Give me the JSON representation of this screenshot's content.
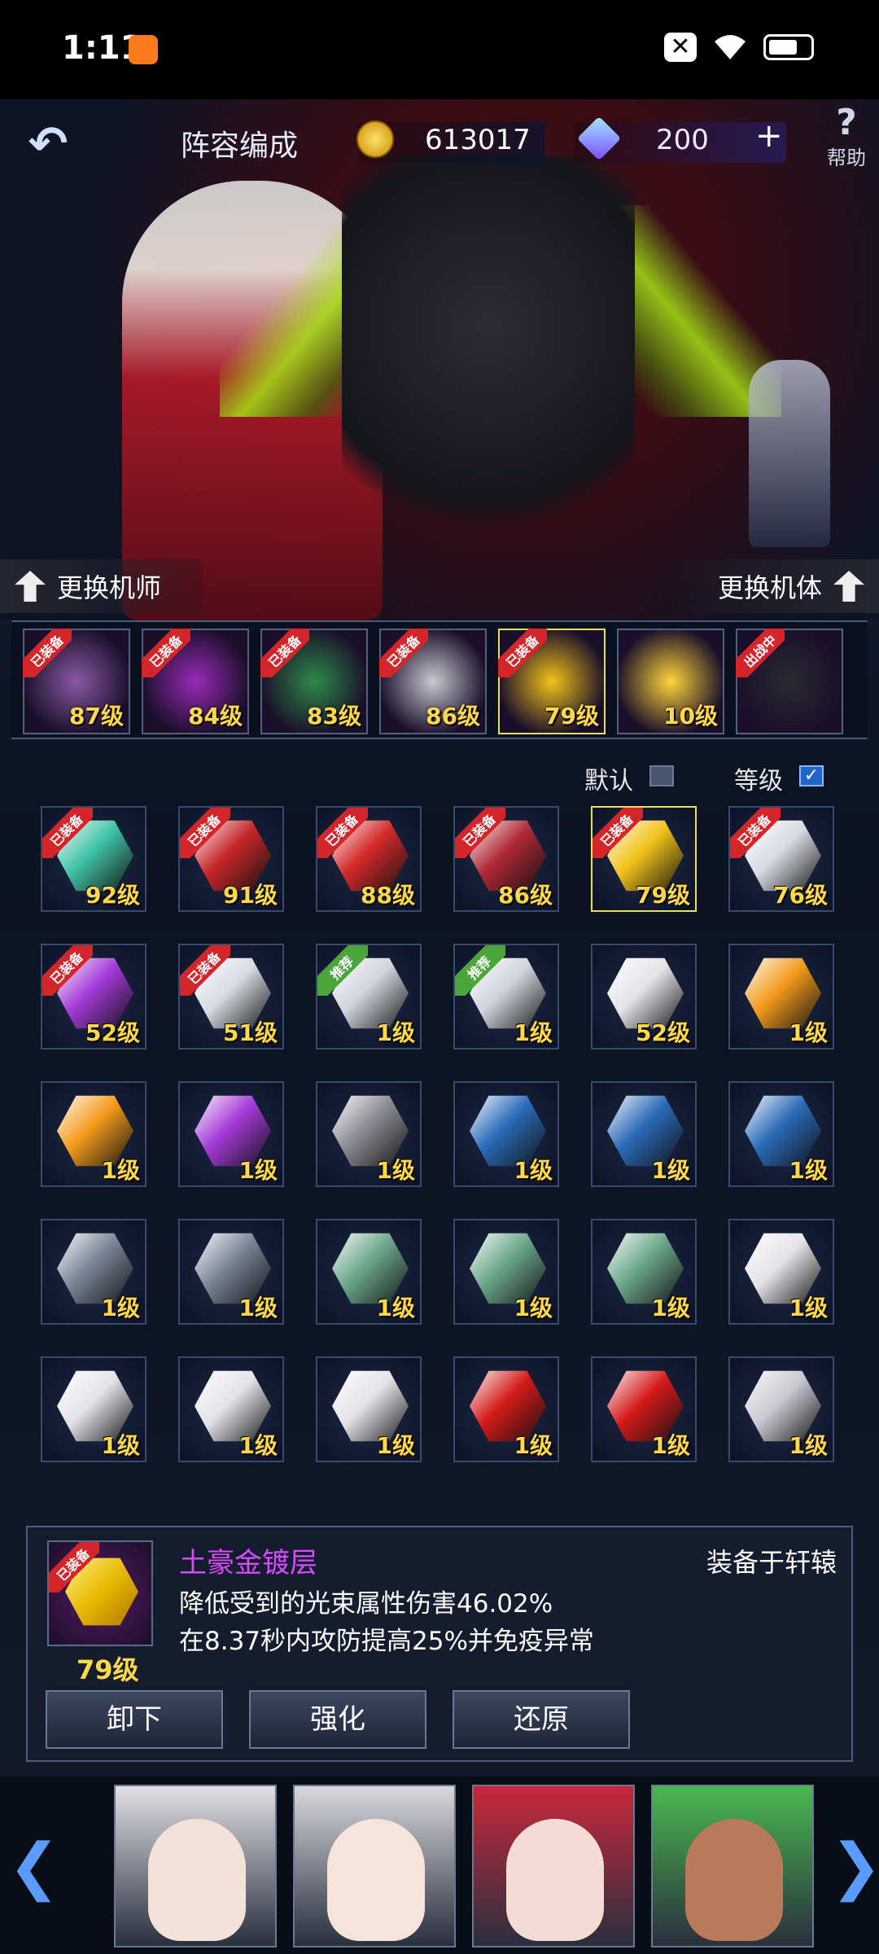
{
  "status_bar": {
    "time": "1:11"
  },
  "header": {
    "title": "阵容编成",
    "coins": "613017",
    "gems": "200",
    "plus": "+",
    "help_label": "帮助",
    "help_symbol": "?",
    "back_symbol": "↶"
  },
  "hero": {
    "change_pilot": "更换机师",
    "change_mech": "更换机体"
  },
  "equipped_strip": [
    {
      "tag": "已装备",
      "level": "87级",
      "color": "#8a5aa6"
    },
    {
      "tag": "已装备",
      "level": "84级",
      "color": "#9a2ab8"
    },
    {
      "tag": "已装备",
      "level": "83级",
      "color": "#2e8a4a"
    },
    {
      "tag": "已装备",
      "level": "86级",
      "color": "#c8c8d0"
    },
    {
      "tag": "已装备",
      "level": "79级",
      "color": "#f2c21a"
    },
    {
      "tag": "",
      "level": "10级",
      "color": "#ffd43a"
    },
    {
      "tag": "出战中",
      "level": "",
      "color": "#2a2a30"
    }
  ],
  "filters": {
    "default": "默认",
    "level": "等级",
    "level_checked": "✓"
  },
  "equipment_grid": [
    {
      "tag": "已装备",
      "tag_type": "equipped",
      "level": "92级",
      "color": "#3fc3a6"
    },
    {
      "tag": "已装备",
      "tag_type": "equipped",
      "level": "91级",
      "color": "#c6262a"
    },
    {
      "tag": "已装备",
      "tag_type": "equipped",
      "level": "88级",
      "color": "#d42a2a"
    },
    {
      "tag": "已装备",
      "tag_type": "equipped",
      "level": "86级",
      "color": "#b02a36"
    },
    {
      "tag": "已装备",
      "tag_type": "equipped",
      "level": "79级",
      "color": "#f2c21a"
    },
    {
      "tag": "已装备",
      "tag_type": "equipped",
      "level": "76级",
      "color": "#d8dce4"
    },
    {
      "tag": "已装备",
      "tag_type": "equipped",
      "level": "52级",
      "color": "#a43ad8"
    },
    {
      "tag": "已装备",
      "tag_type": "equipped",
      "level": "51级",
      "color": "#d8dce4"
    },
    {
      "tag": "推荐",
      "tag_type": "recommend",
      "level": "1级",
      "color": "#d0d4dc"
    },
    {
      "tag": "推荐",
      "tag_type": "recommend",
      "level": "1级",
      "color": "#d0d4dc"
    },
    {
      "tag": "",
      "tag_type": "",
      "level": "52级",
      "color": "#e4e4e8"
    },
    {
      "tag": "",
      "tag_type": "",
      "level": "1级",
      "color": "#f29a1a"
    },
    {
      "tag": "",
      "tag_type": "",
      "level": "1级",
      "color": "#f29a1a"
    },
    {
      "tag": "",
      "tag_type": "",
      "level": "1级",
      "color": "#a43ad8"
    },
    {
      "tag": "",
      "tag_type": "",
      "level": "1级",
      "color": "#8a8a92"
    },
    {
      "tag": "",
      "tag_type": "",
      "level": "1级",
      "color": "#2a6ab8"
    },
    {
      "tag": "",
      "tag_type": "",
      "level": "1级",
      "color": "#2a6ab8"
    },
    {
      "tag": "",
      "tag_type": "",
      "level": "1级",
      "color": "#2a6ab8"
    },
    {
      "tag": "",
      "tag_type": "",
      "level": "1级",
      "color": "#7a8496"
    },
    {
      "tag": "",
      "tag_type": "",
      "level": "1级",
      "color": "#7a8496"
    },
    {
      "tag": "",
      "tag_type": "",
      "level": "1级",
      "color": "#6aa68a"
    },
    {
      "tag": "",
      "tag_type": "",
      "level": "1级",
      "color": "#6aa68a"
    },
    {
      "tag": "",
      "tag_type": "",
      "level": "1级",
      "color": "#6aa68a"
    },
    {
      "tag": "",
      "tag_type": "",
      "level": "1级",
      "color": "#e4e4e8"
    },
    {
      "tag": "",
      "tag_type": "",
      "level": "1级",
      "color": "#e4e4e8"
    },
    {
      "tag": "",
      "tag_type": "",
      "level": "1级",
      "color": "#e4e4e8"
    },
    {
      "tag": "",
      "tag_type": "",
      "level": "1级",
      "color": "#e4e4e8"
    },
    {
      "tag": "",
      "tag_type": "",
      "level": "1级",
      "color": "#d41a1a"
    },
    {
      "tag": "",
      "tag_type": "",
      "level": "1级",
      "color": "#d41a1a"
    },
    {
      "tag": "",
      "tag_type": "",
      "level": "1级",
      "color": "#c8c8d0"
    }
  ],
  "detail": {
    "tag": "已装备",
    "name": "土豪金镀层",
    "equipped_on": "装备于轩辕",
    "line1": "降低受到的光束属性伤害46.02%",
    "line2": "在8.37秒内攻防提高25%并免疫异常",
    "level": "79级",
    "buttons": {
      "unequip": "卸下",
      "enhance": "强化",
      "restore": "还原"
    }
  },
  "roster": {
    "left_arrow": "❮",
    "right_arrow": "❯",
    "portraits": [
      {
        "hair": "#e0e0e4",
        "skin": "#f4e2da"
      },
      {
        "hair": "#d8d8dc",
        "skin": "#f6e4dc"
      },
      {
        "hair": "#c8283c",
        "skin": "#f4dcd4"
      },
      {
        "hair": "#4ab850",
        "skin": "#b87a5a"
      }
    ]
  }
}
